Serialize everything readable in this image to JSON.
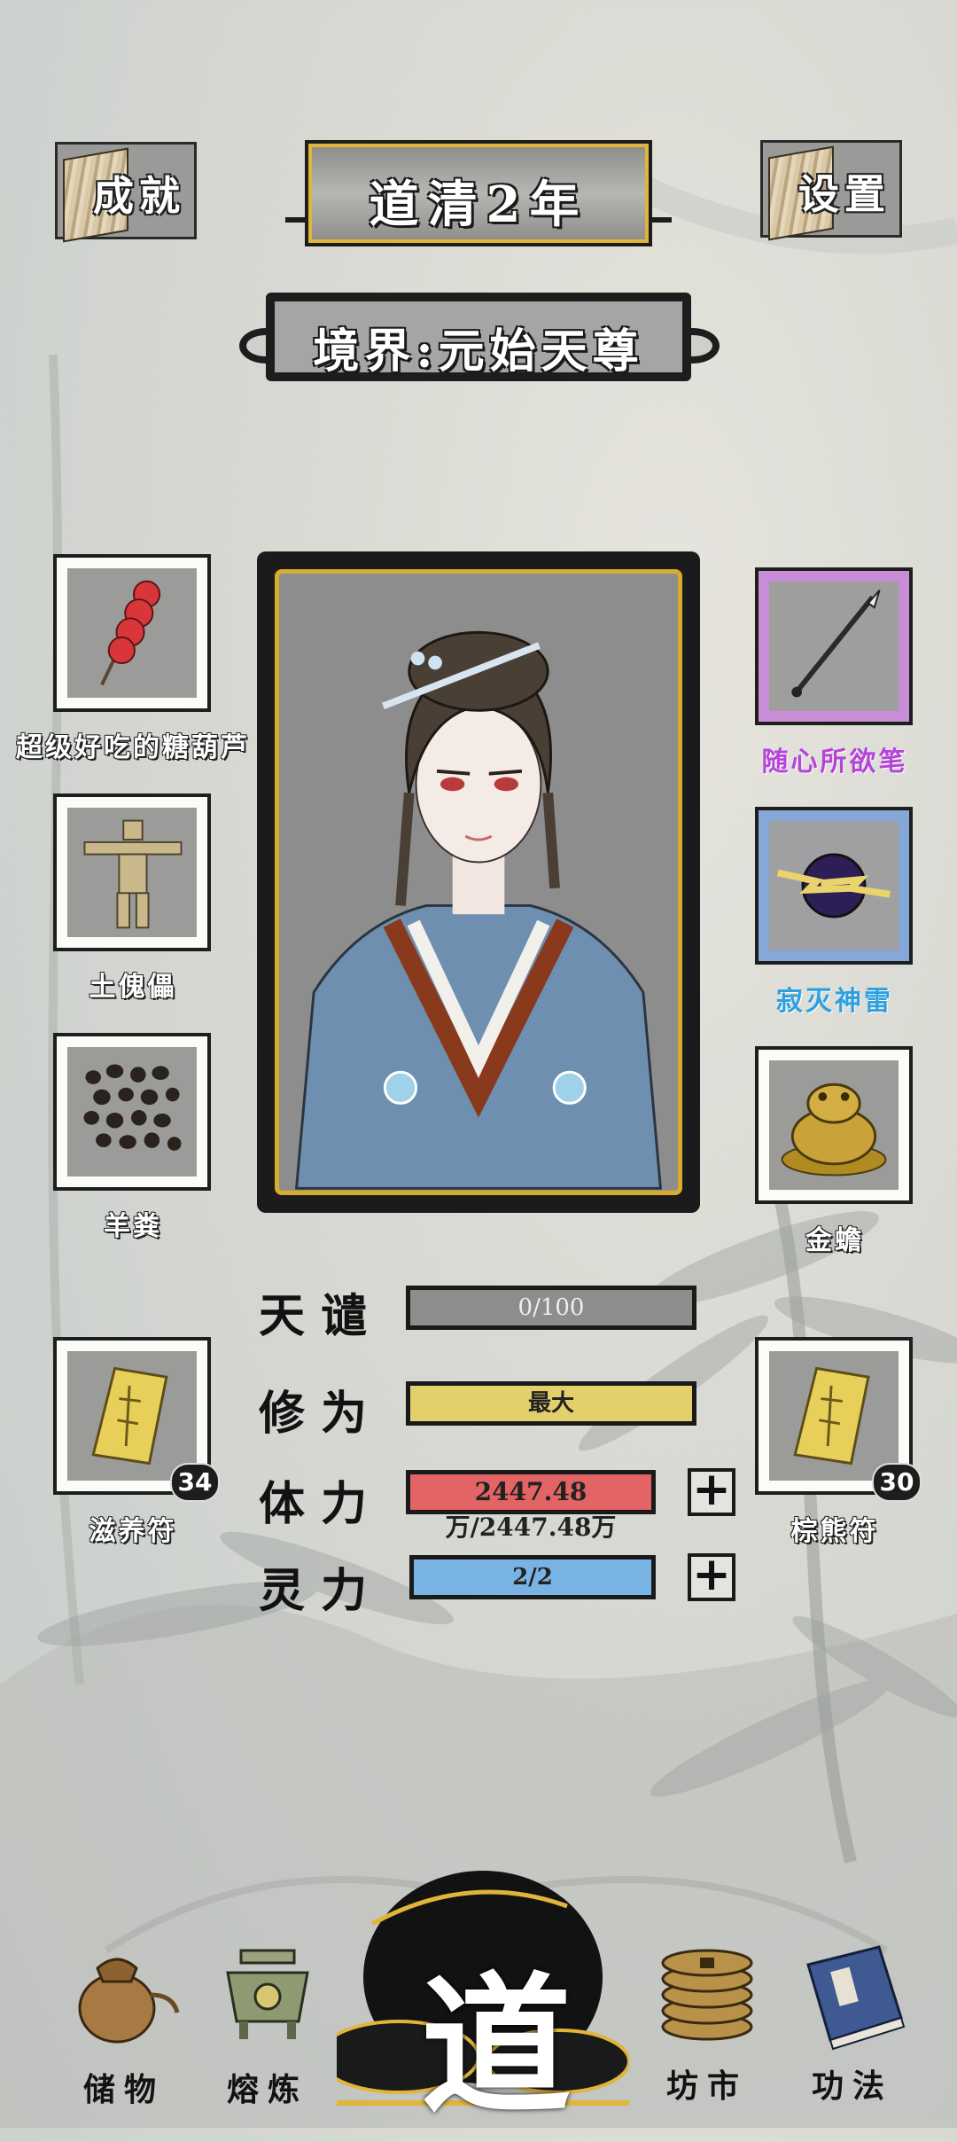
{
  "header": {
    "achievements_label": "成就",
    "title": "道清2年",
    "settings_label": "设置",
    "realm": "境界:元始天尊"
  },
  "left_items": [
    {
      "name": "超级好吃的糖葫芦",
      "icon": "candied-haws-icon",
      "count": ""
    },
    {
      "name": "土傀儡",
      "icon": "earth-puppet-icon",
      "count": ""
    },
    {
      "name": "羊粪",
      "icon": "sheep-dung-icon",
      "count": ""
    },
    {
      "name": "滋养符",
      "icon": "nourish-talisman-icon",
      "count": "34"
    }
  ],
  "right_items": [
    {
      "name": "随心所欲笔",
      "icon": "brush-icon",
      "count": "",
      "rarity": "purple"
    },
    {
      "name": "寂灭神雷",
      "icon": "thunder-orb-icon",
      "count": "",
      "rarity": "blue"
    },
    {
      "name": "金蟾",
      "icon": "golden-toad-icon",
      "count": ""
    },
    {
      "name": "棕熊符",
      "icon": "bear-talisman-icon",
      "count": "30"
    }
  ],
  "stats": {
    "tribulation": {
      "label": "天谴",
      "value": "0/100",
      "fraction": 0
    },
    "cultivation": {
      "label": "修为",
      "value": "最大",
      "fraction": 1
    },
    "stamina": {
      "label": "体力",
      "value": "2447.48万/2447.48万",
      "fraction": 1
    },
    "spirit": {
      "label": "灵力",
      "value": "2/2",
      "fraction": 1
    }
  },
  "nav": {
    "storage": "储物",
    "smelt": "熔炼",
    "dao": "道",
    "market": "坊市",
    "skills": "功法"
  },
  "colors": {
    "gold": "#d8ad2e",
    "purple_rarity": "#c98dd8",
    "blue_rarity": "#85a8d8",
    "stamina_red": "#e36464",
    "spirit_blue": "#79b3e4",
    "cultivation_yellow": "#e4d06a"
  }
}
